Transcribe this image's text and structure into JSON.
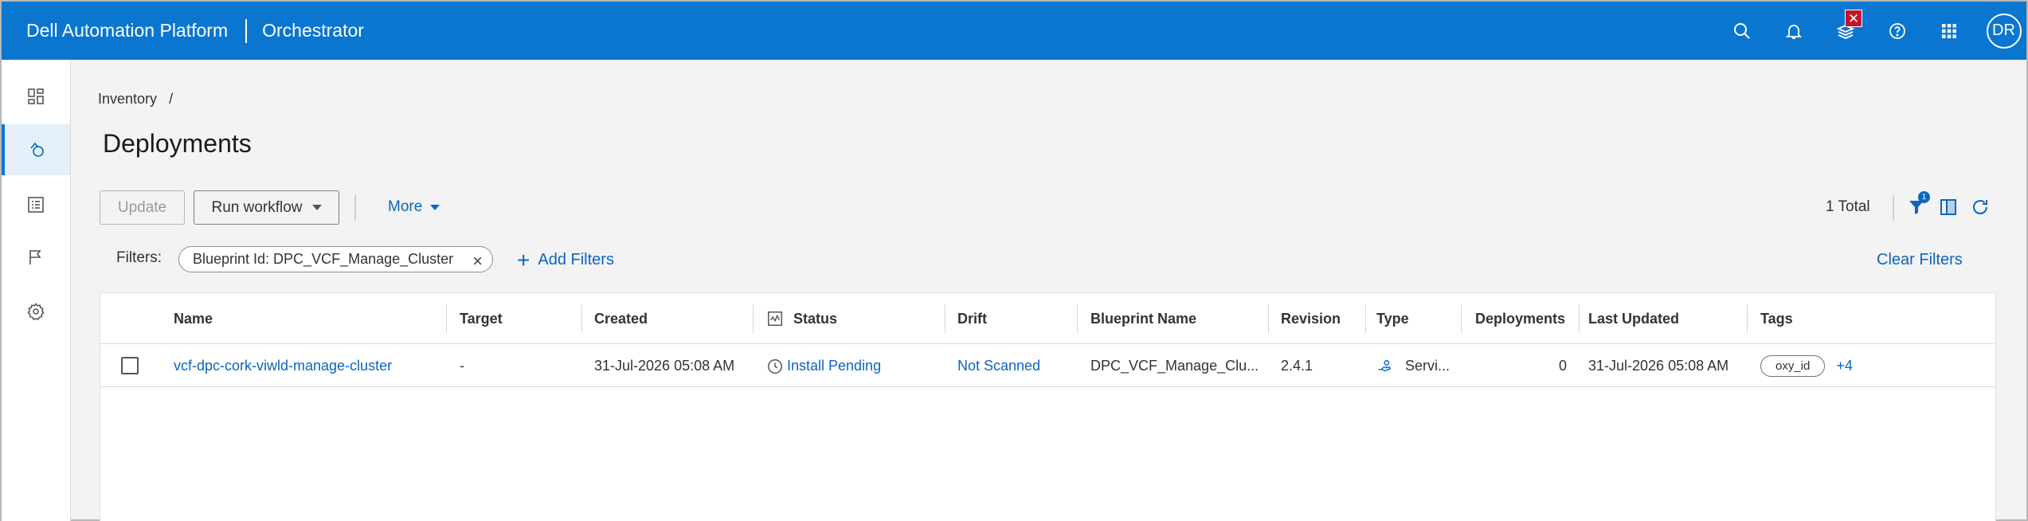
{
  "app": {
    "brand": "Dell Automation Platform",
    "product": "Orchestrator",
    "avatar_initials": "DR",
    "close_badge": "✕"
  },
  "colors": {
    "topbar": "#0a76d0",
    "link": "#0a66c2",
    "background": "#f3f3f3"
  },
  "sidebar": {
    "items": [
      {
        "icon": "dashboard-icon",
        "active": false
      },
      {
        "icon": "deployments-icon",
        "active": true
      },
      {
        "icon": "catalog-list-icon",
        "active": false
      },
      {
        "icon": "flag-icon",
        "active": false
      },
      {
        "icon": "settings-gear-icon",
        "active": false
      }
    ]
  },
  "breadcrumb": {
    "root": "Inventory",
    "separator": "/"
  },
  "page": {
    "title": "Deployments"
  },
  "toolbar": {
    "update_label": "Update",
    "run_workflow_label": "Run workflow",
    "more_label": "More",
    "total_label": "1 Total",
    "filter_count": "1"
  },
  "filters": {
    "label": "Filters:",
    "chips": [
      "Blueprint Id: DPC_VCF_Manage_Cluster"
    ],
    "add_label": "Add Filters",
    "clear_label": "Clear Filters"
  },
  "table": {
    "columns": [
      "Name",
      "Target",
      "Created",
      "Status",
      "Drift",
      "Blueprint Name",
      "Revision",
      "Type",
      "Deployments",
      "Last Updated",
      "Tags"
    ],
    "rows": [
      {
        "name": "vcf-dpc-cork-viwld-manage-cluster",
        "target": "-",
        "created": "31-Jul-2026 05:08 AM",
        "status": "Install Pending",
        "drift": "Not Scanned",
        "blueprint_name": "DPC_VCF_Manage_Clu...",
        "revision": "2.4.1",
        "type": "Servi...",
        "deployments": "0",
        "last_updated": "31-Jul-2026 05:08 AM",
        "tag": "oxy_id",
        "tags_more": "+4"
      }
    ]
  }
}
